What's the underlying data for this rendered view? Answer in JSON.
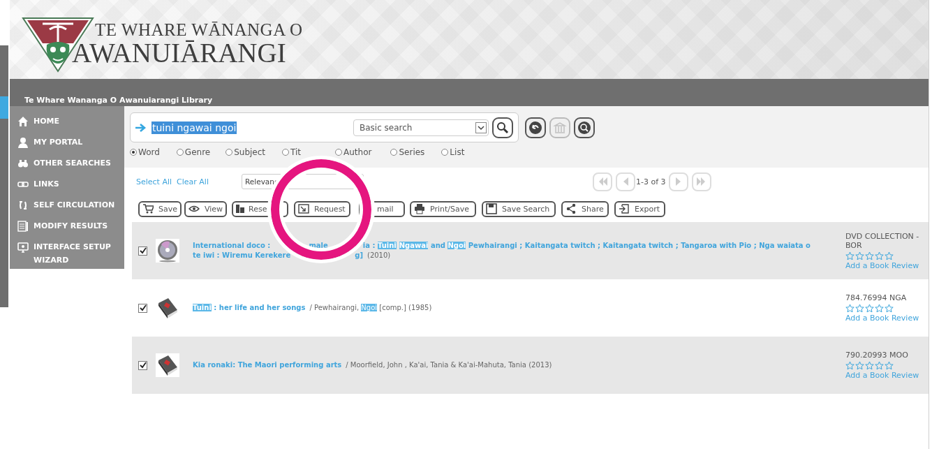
{
  "header": {
    "logo_line_1": "TE WHARE WĀNANGA O",
    "logo_line_2": "AWANUIĀRANGI"
  },
  "library_title": "Te Whare Wananga O Awanuiarangi Library",
  "sidebar": {
    "items": [
      {
        "label": "HOME"
      },
      {
        "label": "MY PORTAL"
      },
      {
        "label": "OTHER SEARCHES"
      },
      {
        "label": "LINKS"
      },
      {
        "label": "SELF CIRCULATION"
      },
      {
        "label": "MODIFY RESULTS"
      },
      {
        "label": "INTERFACE SETUP WIZARD"
      }
    ]
  },
  "search": {
    "query": "tuini ngawai ngoi",
    "query_selected": true,
    "mode": "Basic search",
    "tool_buttons": [
      {
        "disabled": false
      },
      {
        "disabled": true
      },
      {
        "disabled": false
      }
    ],
    "scopes": [
      {
        "label": "Word",
        "selected": true
      },
      {
        "label": "Genre",
        "selected": false
      },
      {
        "label": "Subject",
        "selected": false
      },
      {
        "label": "Tit",
        "selected": false
      },
      {
        "label": "Author",
        "selected": false
      },
      {
        "label": "Series",
        "selected": false
      },
      {
        "label": "List",
        "selected": false
      }
    ]
  },
  "results_toolbar": {
    "select_all": "Select All",
    "clear_all": "Clear All",
    "sort": "Relevanc",
    "range": "1-3 of 3",
    "actions": [
      "Save",
      "View",
      "Rese",
      "Request",
      "mail",
      "Print/Save",
      "Save Search",
      "Share",
      "Export"
    ]
  },
  "results": [
    {
      "kind": "dvd",
      "checked": true,
      "lines": [
        [
          {
            "kind": "text",
            "text": "International doco :"
          },
          {
            "kind": "gap"
          },
          {
            "kind": "text",
            "text": "male"
          },
          {
            "kind": "gap"
          },
          {
            "kind": "text",
            "text": "ia : "
          },
          {
            "kind": "hit",
            "text": "Tuini"
          },
          {
            "kind": "hit",
            "text": "Ngawai"
          },
          {
            "kind": "text",
            "text": " and "
          },
          {
            "kind": "hit",
            "text": "Ngoi"
          },
          {
            "kind": "text",
            "text": " Pewhairangi ; Kaitangata twitch ; Kaitangata twitch ; Tangaroa with Pio ; Nga waiata o"
          }
        ],
        [
          {
            "kind": "text",
            "text": "te iwi : Wiremu Kerekere"
          },
          {
            "kind": "widegap"
          },
          {
            "kind": "text",
            "text": "g]"
          },
          {
            "kind": "meta",
            "text": "(2010)"
          }
        ]
      ],
      "call_number": "DVD COLLECTION - BOR",
      "stars": 0,
      "review": "Add a Book Review"
    },
    {
      "kind": "book",
      "checked": true,
      "lines": [
        [
          {
            "kind": "hit",
            "text": "Tuini"
          },
          {
            "kind": "text",
            "text": " : her life and her songs"
          },
          {
            "kind": "meta",
            "text": "/  Pewhairangi, "
          },
          {
            "kind": "metahit",
            "text": "Ngoi"
          },
          {
            "kind": "meta",
            "text": " [comp.]  (1985)"
          }
        ]
      ],
      "call_number": "784.76994 NGA",
      "stars": 0,
      "review": "Add a Book Review"
    },
    {
      "kind": "book",
      "checked": true,
      "lines": [
        [
          {
            "kind": "text",
            "text": "Kia ronaki: The Maori performing arts"
          },
          {
            "kind": "meta",
            "text": "/  Moorfield, John ,  Ka'ai, Tania  &  Ka'ai-Mahuta, Tania  (2013)"
          }
        ]
      ],
      "call_number": "790.20993 MOO",
      "stars": 0,
      "review": "Add a Book Review"
    }
  ]
}
